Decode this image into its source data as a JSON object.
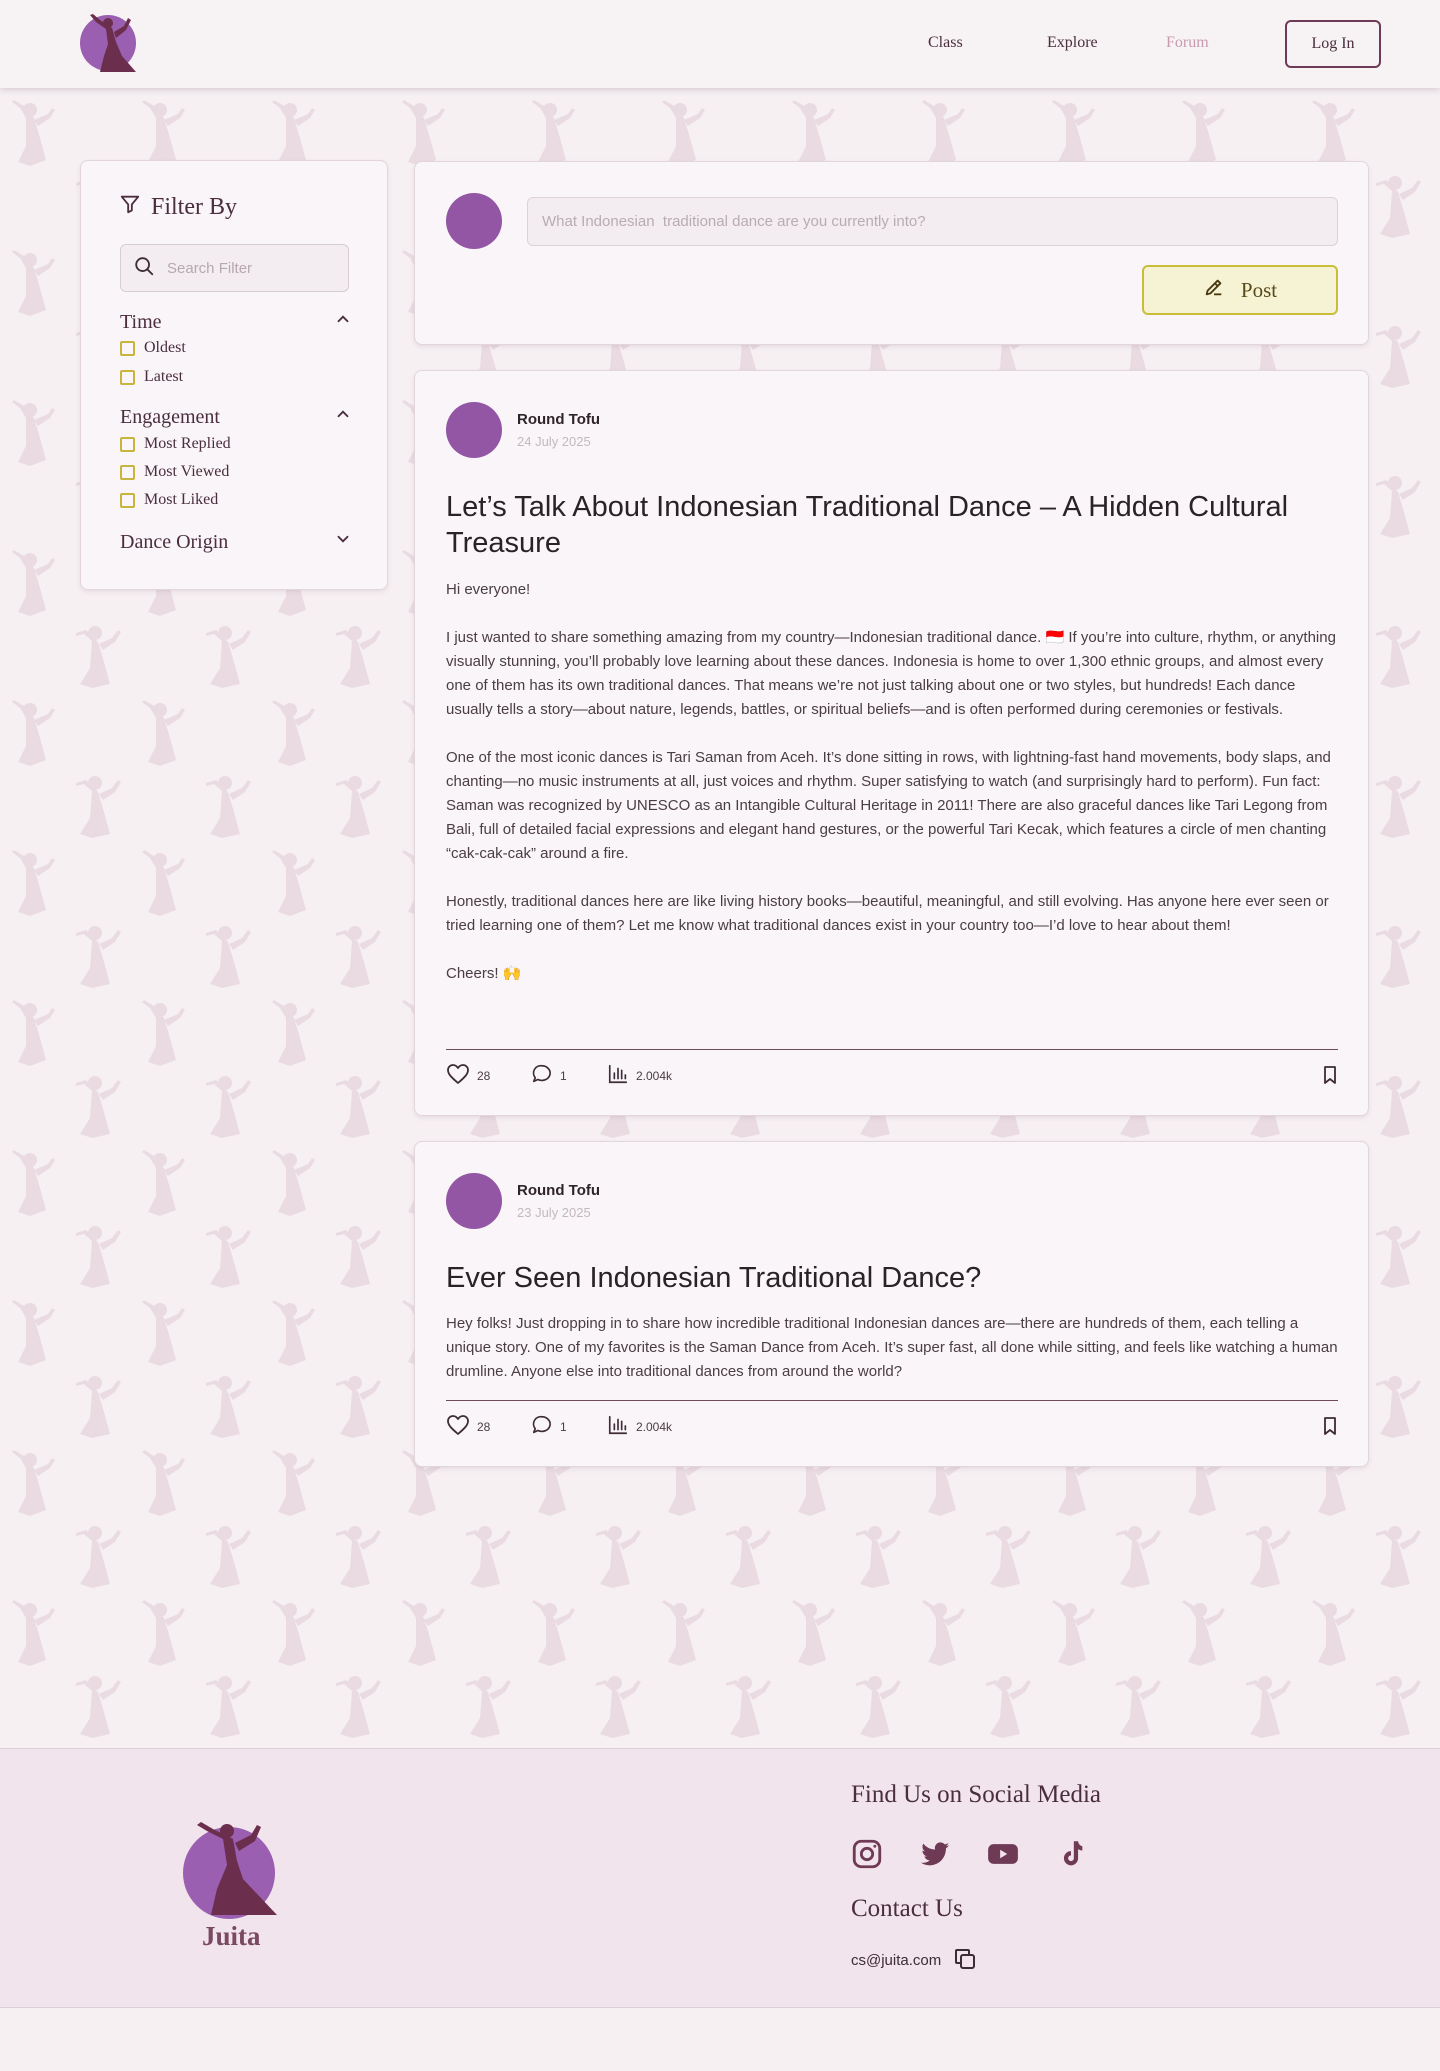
{
  "nav": {
    "links": [
      "Class",
      "Explore",
      "Forum"
    ],
    "active": "Forum",
    "login_label": "Log In"
  },
  "filter": {
    "title": "Filter By",
    "search_placeholder": "Search Filter",
    "groups": [
      {
        "label": "Time",
        "expanded": true,
        "options": [
          "Oldest",
          "Latest"
        ]
      },
      {
        "label": "Engagement",
        "expanded": true,
        "options": [
          "Most Replied",
          "Most Viewed",
          "Most Liked"
        ]
      },
      {
        "label": "Dance Origin",
        "expanded": false,
        "options": []
      }
    ]
  },
  "composer": {
    "placeholder": "What Indonesian  traditional dance are you currently into?",
    "post_label": "Post"
  },
  "posts": [
    {
      "author": "Round Tofu",
      "date": "24 July 2025",
      "title": "Let’s Talk About Indonesian Traditional Dance – A Hidden Cultural Treasure",
      "paragraphs": [
        "Hi everyone!",
        "I just wanted to share something amazing from my country—Indonesian traditional dance. 🇮🇩 If you’re into culture, rhythm, or anything visually stunning, you’ll probably love learning about these dances. Indonesia is home to over 1,300 ethnic groups, and almost every one of them has its own traditional dances. That means we’re not just talking about one or two styles, but hundreds! Each dance usually tells a story—about nature, legends, battles, or spiritual beliefs—and is often performed during ceremonies or festivals.",
        "One of the most iconic dances is Tari Saman from Aceh. It’s done sitting in rows, with lightning-fast hand movements, body slaps, and chanting—no music instruments at all, just voices and rhythm. Super satisfying to watch (and surprisingly hard to perform). Fun fact: Saman was recognized by UNESCO as an Intangible Cultural Heritage in 2011! There are also graceful dances like Tari Legong from Bali, full of detailed facial expressions and elegant hand gestures, or the powerful Tari Kecak, which features a circle of men chanting “cak-cak-cak” around a fire.",
        "Honestly, traditional dances here are like living history books—beautiful, meaningful, and still evolving. Has anyone here ever seen or tried learning one of them? Let me know what traditional dances exist in your country too—I’d love to hear about them!",
        "Cheers! 🙌"
      ],
      "likes": "28",
      "comments": "1",
      "views": "2.004k"
    },
    {
      "author": "Round Tofu",
      "date": "23 July 2025",
      "title": "Ever Seen Indonesian Traditional Dance?",
      "paragraphs": [
        "Hey folks! Just dropping in to share how incredible traditional Indonesian dances are—there are hundreds of them, each telling a unique story. One of my favorites is the Saman Dance from Aceh. It’s super fast, all done while sitting, and feels like watching a human drumline. Anyone else into traditional dances from around the world?"
      ],
      "likes": "28",
      "comments": "1",
      "views": "2.004k"
    }
  ],
  "footer": {
    "brand": "Juita",
    "social_heading": "Find Us on Social Media",
    "social_icons": [
      "instagram-icon",
      "twitter-icon",
      "youtube-icon",
      "tiktok-icon"
    ],
    "contact_heading": "Contact Us",
    "email": "cs@juita.com"
  },
  "colors": {
    "brand_purple": "#9256a4",
    "text_dark": "#4a2e3e",
    "accent_yellow": "#c8be3a",
    "active_link": "#c99bb0",
    "footer_bg": "#f2e4ec"
  }
}
